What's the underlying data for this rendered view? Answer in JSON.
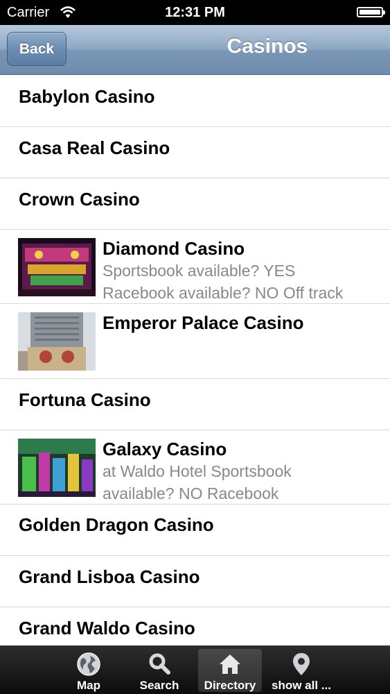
{
  "status_bar": {
    "carrier": "Carrier",
    "time": "12:31 PM"
  },
  "nav": {
    "back_label": "Back",
    "title": "Casinos"
  },
  "rows": [
    {
      "title": "Babylon Casino"
    },
    {
      "title": "Casa Real Casino"
    },
    {
      "title": "Crown Casino"
    },
    {
      "title": "Diamond Casino",
      "subtitle_1": "Sportsbook available? YES",
      "subtitle_2": "Racebook available? NO Off track"
    },
    {
      "title": "Emperor Palace Casino"
    },
    {
      "title": "Fortuna Casino"
    },
    {
      "title": "Galaxy Casino",
      "subtitle_1": "at Waldo Hotel Sportsbook",
      "subtitle_2": "available? NO Racebook"
    },
    {
      "title": "Golden Dragon Casino"
    },
    {
      "title": "Grand Lisboa Casino"
    },
    {
      "title": "Grand Waldo Casino"
    }
  ],
  "tabs": [
    {
      "label": "Map",
      "icon": "globe-icon"
    },
    {
      "label": "Search",
      "icon": "search-icon"
    },
    {
      "label": "Directory",
      "icon": "home-icon"
    },
    {
      "label": "show all ...",
      "icon": "location-pin-icon"
    }
  ],
  "colors": {
    "nav_top": "#b6c9dd",
    "nav_bottom": "#6d8bac",
    "tab_bar": "#1a1a1a",
    "subtitle": "#888888"
  }
}
